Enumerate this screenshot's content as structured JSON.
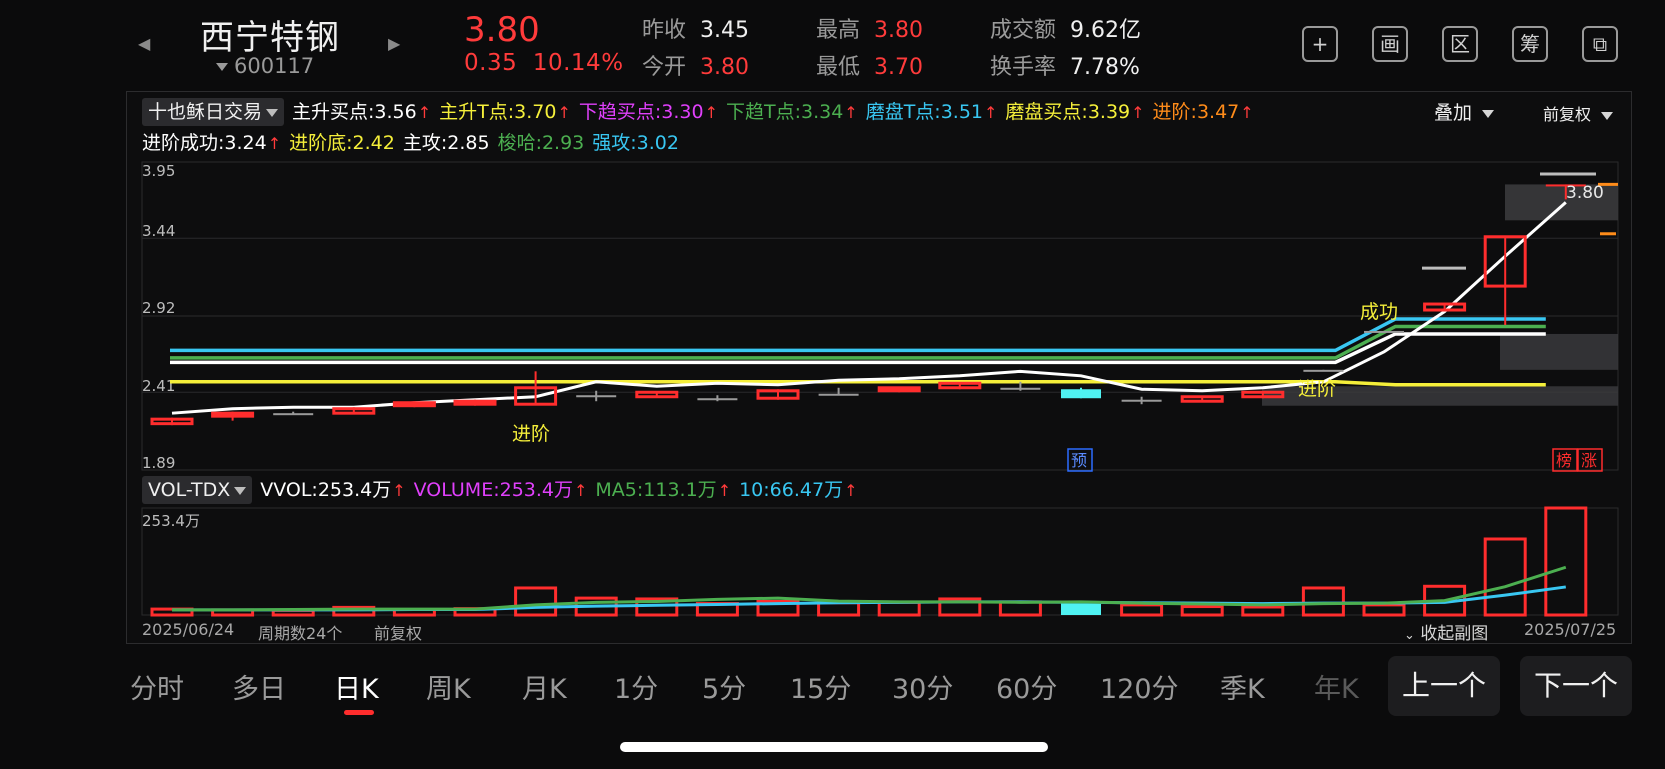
{
  "header": {
    "stock_name": "西宁特钢",
    "stock_code": "600117",
    "price": "3.80",
    "change": "0.35",
    "change_pct": "10.14%",
    "stats": [
      {
        "label": "昨收",
        "value": "3.45",
        "color": "white"
      },
      {
        "label": "今开",
        "value": "3.80",
        "color": "red"
      },
      {
        "label": "最高",
        "value": "3.80",
        "color": "red"
      },
      {
        "label": "最低",
        "value": "3.70",
        "color": "red"
      },
      {
        "label": "成交额",
        "value": "9.62亿",
        "color": "white"
      },
      {
        "label": "换手率",
        "value": "7.78%",
        "color": "white"
      }
    ],
    "icons": [
      "plus-icon",
      "draw-icon",
      "range-icon",
      "chips-icon",
      "switch-device-icon"
    ],
    "icon_glyphs": [
      "+",
      "画",
      "区",
      "筹",
      "⧉"
    ]
  },
  "indicator": {
    "name": "十也稣日交易",
    "items": [
      {
        "label": "主升买点:3.56",
        "color": "#ffffff"
      },
      {
        "label": "主升T点:3.70",
        "color": "#f5ef3a"
      },
      {
        "label": "下趋买点:3.30",
        "color": "#e040fb"
      },
      {
        "label": "下趋T点:3.34",
        "color": "#4caf50"
      },
      {
        "label": "磨盘T点:3.51",
        "color": "#39c7f2"
      },
      {
        "label": "磨盘买点:3.39",
        "color": "#f5ef3a"
      },
      {
        "label": "进阶:3.47",
        "color": "#ff8c1a"
      }
    ],
    "items2": [
      {
        "label": "进阶成功:3.24",
        "color": "#ffffff",
        "arrow": true
      },
      {
        "label": "进阶底:2.42",
        "color": "#f5ef3a",
        "arrow": false
      },
      {
        "label": "主攻:2.85",
        "color": "#ffffff",
        "arrow": false
      },
      {
        "label": "梭哈:2.93",
        "color": "#4caf50",
        "arrow": false
      },
      {
        "label": "强攻:3.02",
        "color": "#39c7f2",
        "arrow": false
      }
    ],
    "overlay_label": "叠加",
    "adjust_label": "前复权"
  },
  "price_axis": {
    "ticks": [
      "3.95",
      "3.44",
      "2.92",
      "2.41",
      "1.89"
    ]
  },
  "annotations": {
    "jinjie_1": "进阶",
    "jinjie_2": "进阶",
    "success": "成功",
    "forecast": "预",
    "rank": "榜",
    "rise": "涨",
    "last_price": "3.80"
  },
  "chart_data": {
    "type": "candlestick",
    "x": [
      "2025/06/24",
      "",
      "",
      "",
      "",
      "",
      "",
      "",
      "",
      "",
      "",
      "",
      "",
      "",
      "",
      "",
      "",
      "",
      "",
      "",
      "",
      "",
      "",
      "2025/07/25"
    ],
    "ohlc": [
      [
        2.2,
        2.24,
        2.19,
        2.23
      ],
      [
        2.25,
        2.28,
        2.22,
        2.27
      ],
      [
        2.27,
        2.28,
        2.26,
        2.27
      ],
      [
        2.27,
        2.31,
        2.27,
        2.3
      ],
      [
        2.32,
        2.35,
        2.31,
        2.34
      ],
      [
        2.33,
        2.36,
        2.32,
        2.35
      ],
      [
        2.33,
        2.55,
        2.33,
        2.44
      ],
      [
        2.39,
        2.42,
        2.35,
        2.39
      ],
      [
        2.38,
        2.41,
        2.38,
        2.41
      ],
      [
        2.37,
        2.39,
        2.35,
        2.37
      ],
      [
        2.37,
        2.43,
        2.36,
        2.42
      ],
      [
        2.4,
        2.44,
        2.39,
        2.4
      ],
      [
        2.42,
        2.44,
        2.41,
        2.44
      ],
      [
        2.44,
        2.47,
        2.43,
        2.47
      ],
      [
        2.44,
        2.48,
        2.42,
        2.44
      ],
      [
        2.43,
        2.44,
        2.37,
        2.37
      ],
      [
        2.36,
        2.38,
        2.33,
        2.36
      ],
      [
        2.35,
        2.38,
        2.35,
        2.38
      ],
      [
        2.38,
        2.41,
        2.37,
        2.41
      ],
      [
        2.56,
        2.56,
        2.55,
        2.56
      ],
      [
        2.82,
        2.82,
        2.82,
        2.82
      ],
      [
        2.96,
        3.0,
        2.96,
        3.0
      ],
      [
        3.12,
        3.45,
        2.86,
        3.45
      ],
      [
        3.8,
        3.8,
        3.7,
        3.8
      ]
    ],
    "ma_white": [
      2.27,
      2.3,
      2.31,
      2.31,
      2.34,
      2.36,
      2.38,
      2.48,
      2.45,
      2.47,
      2.46,
      2.49,
      2.5,
      2.52,
      2.55,
      2.52,
      2.43,
      2.42,
      2.44,
      2.48,
      2.68,
      2.95,
      3.32,
      3.68
    ],
    "levels": [
      {
        "name": "强攻",
        "value": 2.69,
        "value_after": 2.9,
        "color": "#39c7f2"
      },
      {
        "name": "梭哈",
        "value": 2.64,
        "value_after": 2.85,
        "color": "#4caf50"
      },
      {
        "name": "主攻",
        "value": 2.61,
        "value_after": 2.8,
        "color": "#ffffff"
      },
      {
        "name": "进阶底",
        "value": 2.48,
        "value_after": 2.46,
        "color": "#f5ef3a"
      }
    ],
    "ylim": [
      1.89,
      3.95
    ],
    "volume": {
      "values": [
        14,
        12,
        11,
        18,
        13,
        15,
        64,
        40,
        38,
        27,
        32,
        29,
        30,
        38,
        31,
        28,
        24,
        20,
        19,
        64,
        24,
        68,
        180,
        253.4
      ],
      "ma5": [
        12,
        12,
        13,
        14,
        14,
        14,
        24,
        30,
        32,
        37,
        40,
        33,
        31,
        31,
        30,
        31,
        28,
        26,
        24,
        27,
        28,
        34,
        67,
        113.1
      ],
      "ma10": [
        12,
        12,
        12,
        12,
        13,
        13,
        18,
        21,
        23,
        25,
        27,
        29,
        30,
        31,
        31,
        30,
        29,
        28,
        27,
        28,
        28,
        30,
        47,
        66.47
      ],
      "ylim": [
        0,
        253.4
      ]
    }
  },
  "vol": {
    "name": "VOL-TDX",
    "items": [
      {
        "label": "VVOL:253.4万",
        "color": "#ffffff"
      },
      {
        "label": "VOLUME:253.4万",
        "color": "#e040fb"
      },
      {
        "label": "MA5:113.1万",
        "color": "#4caf50"
      },
      {
        "label": "10:66.47万",
        "color": "#39c7f2"
      }
    ],
    "max_label": "253.4万"
  },
  "footer": {
    "start_date": "2025/06/24",
    "period_count": "周期数24个",
    "adjust": "前复权",
    "collapse": "收起副图",
    "end_date": "2025/07/25"
  },
  "tabs": [
    "分时",
    "多日",
    "日K",
    "周K",
    "月K",
    "1分",
    "5分",
    "15分",
    "30分",
    "60分",
    "120分",
    "季K",
    "年K"
  ],
  "active_tab": "日K",
  "nav": {
    "prev": "上一个",
    "next": "下一个"
  }
}
